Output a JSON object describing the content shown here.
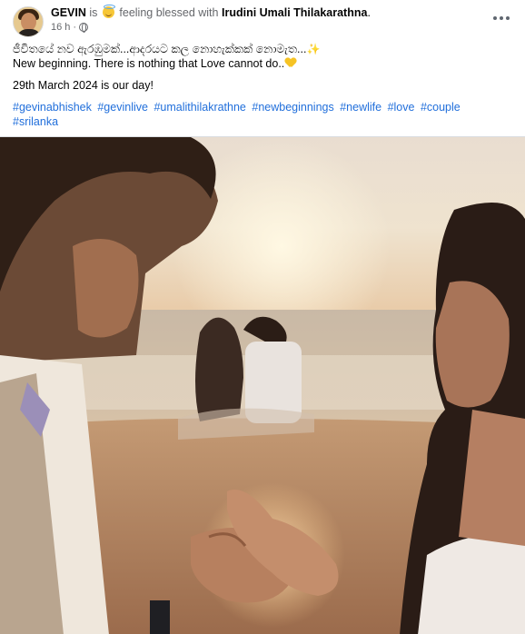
{
  "post": {
    "author": "GEVIN",
    "is_text": "is",
    "feeling_icon": "innocent-smile-emoji",
    "feeling_text": "feeling blessed with",
    "tagged_person": "Irudini Umali Thilakarathna",
    "period": ".",
    "time": "16 h",
    "separator": "·",
    "privacy_icon": "globe-icon",
    "more_icon": "more-options-icon",
    "line1_sinhala": "ජීවිතයේ නව ඇරඹුමක්...ආදරයට කල නොහැක්කක් නොමැත...",
    "line1_emoji": "✨",
    "line2": "New beginning. There is nothing that Love cannot do..",
    "line2_emoji": "yellow-heart",
    "line3": "29th March 2024 is our day!",
    "hashtags": [
      "#gevinabhishek",
      "#gevinlive",
      "#umalithilakrathne",
      "#newbeginnings",
      "#newlife",
      "#love",
      "#couple",
      "#srilanka"
    ],
    "photo_description_icon": "engagement-photo"
  },
  "colors": {
    "link": "#216fdb",
    "muted": "#65676b",
    "text": "#050505"
  }
}
